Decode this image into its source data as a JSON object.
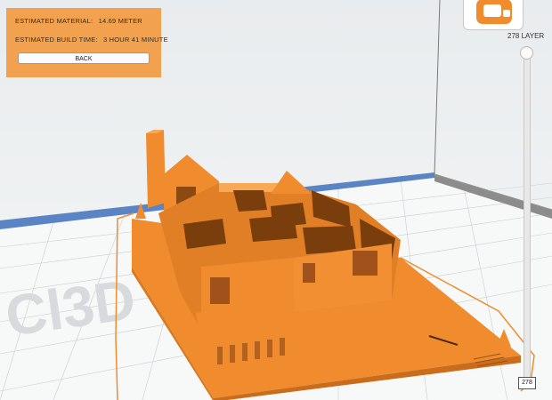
{
  "info": {
    "material_label": "ESTIMATED MATERIAL:",
    "material_value": "14.69 METER",
    "time_label": "ESTIMATED BUILD TIME:",
    "time_value": "3 HOUR 41 MINUTE",
    "back_label": "BACK"
  },
  "layer": {
    "label": "278 LAYER",
    "value": "278"
  },
  "colors": {
    "model": "#f08c2e",
    "panel": "#f2a24e",
    "axis_blue": "#5b84c4"
  },
  "icons": {
    "logo": "app-logo-icon"
  }
}
